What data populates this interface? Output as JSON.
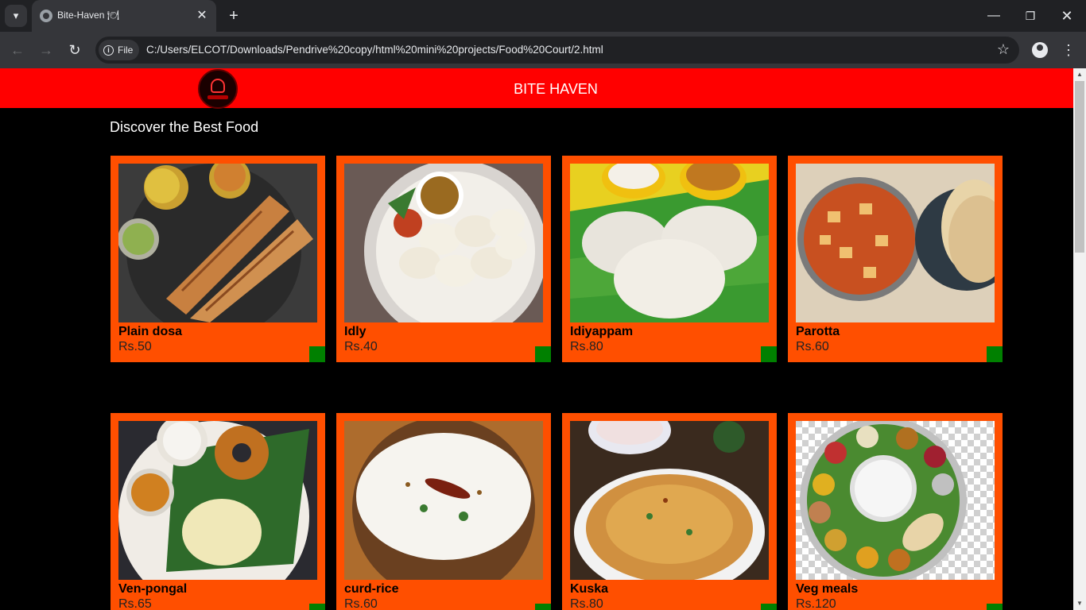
{
  "browser": {
    "tab_title": "Bite-Haven 🍽",
    "url": "C:/Users/ELCOT/Downloads/Pendrive%20copy/html%20mini%20projects/Food%20Court/2.html",
    "file_chip": "File",
    "icons": {
      "tab_menu": "▾",
      "close": "✕",
      "new_tab": "+",
      "minimize": "—",
      "restore": "❐",
      "win_close": "✕",
      "back": "←",
      "forward": "→",
      "reload": "↻",
      "star": "☆",
      "kebab": "⋮",
      "info": "i",
      "scroll_up": "▲",
      "scroll_down": "▼"
    }
  },
  "site": {
    "title": "BITE HAVEN",
    "tagline": "Discover the Best Food"
  },
  "menu": [
    {
      "name": "Plain dosa",
      "price": "Rs.50",
      "image": "plain-dosa"
    },
    {
      "name": "Idly",
      "price": "Rs.40",
      "image": "idly"
    },
    {
      "name": "Idiyappam",
      "price": "Rs.80",
      "image": "idiyappam"
    },
    {
      "name": "Parotta",
      "price": "Rs.60",
      "image": "parotta"
    },
    {
      "name": "Ven-pongal",
      "price": "Rs.65",
      "image": "ven-pongal"
    },
    {
      "name": "curd-rice",
      "price": "Rs.60",
      "image": "curd-rice"
    },
    {
      "name": "Kuska",
      "price": "Rs.80",
      "image": "kuska"
    },
    {
      "name": "Veg meals",
      "price": "Rs.120",
      "image": "veg-meals"
    }
  ],
  "colors": {
    "header": "#ff0000",
    "card": "#ff4f00",
    "cart_button": "#008000"
  }
}
